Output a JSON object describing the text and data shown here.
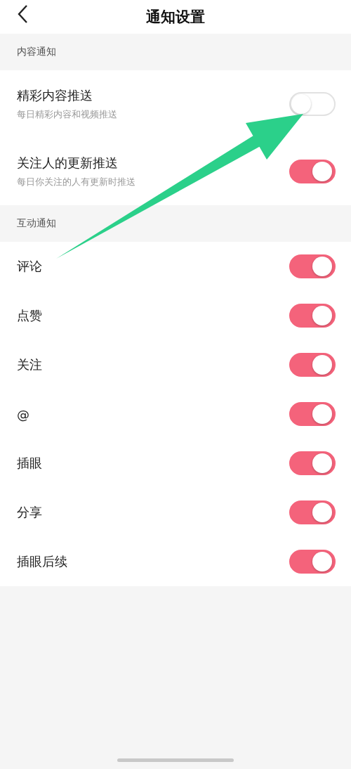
{
  "header": {
    "title": "通知设置"
  },
  "sections": [
    {
      "title": "内容通知",
      "rows": [
        {
          "label": "精彩内容推送",
          "subtitle": "每日精彩内容和视频推送",
          "on": false
        },
        {
          "label": "关注人的更新推送",
          "subtitle": "每日你关注的人有更新时推送",
          "on": true
        }
      ]
    },
    {
      "title": "互动通知",
      "rows": [
        {
          "label": "评论",
          "on": true
        },
        {
          "label": "点赞",
          "on": true
        },
        {
          "label": "关注",
          "on": true
        },
        {
          "label": "@",
          "on": true
        },
        {
          "label": "插眼",
          "on": true
        },
        {
          "label": "分享",
          "on": true
        },
        {
          "label": "插眼后续",
          "on": true
        }
      ]
    }
  ]
}
